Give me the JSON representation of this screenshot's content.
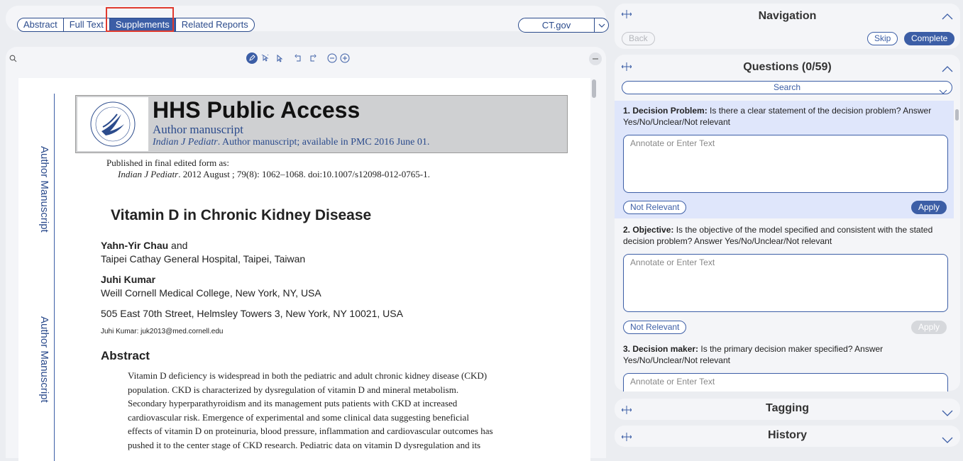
{
  "tabs": [
    {
      "label": "Abstract",
      "active": false
    },
    {
      "label": "Full Text",
      "active": false
    },
    {
      "label": "Supplements",
      "active": true
    },
    {
      "label": "Related Reports",
      "active": false
    }
  ],
  "source_select": {
    "value": "CT.gov"
  },
  "document": {
    "side_label_top": "Author Manuscript",
    "side_label_bottom": "Author Manuscript",
    "banner_title": "HHS Public Access",
    "banner_sub1": "Author manuscript",
    "banner_sub2_journal": "Indian J Pediatr",
    "banner_sub2_rest": ". Author manuscript; available in PMC 2016 June 01.",
    "published_label": "Published in final edited form as:",
    "citation_journal": "Indian J Pediatr",
    "citation_rest": ". 2012 August ; 79(8): 1062–1068. doi:10.1007/s12098-012-0765-1.",
    "title": "Vitamin D in Chronic Kidney Disease",
    "author1_name": "Yahn-Yir Chau",
    "author1_and": " and",
    "author1_affil": "Taipei Cathay General Hospital, Taipei, Taiwan",
    "author2_name": "Juhi Kumar",
    "author2_affil": "Weill Cornell Medical College, New York, NY, USA",
    "address": "505 East 70th Street, Helmsley Towers 3, New York, NY 10021, USA",
    "email": "Juhi Kumar: juk2013@med.cornell.edu",
    "abstract_heading": "Abstract",
    "abstract_lines": [
      "Vitamin D deficiency is widespread in both the pediatric and adult chronic kidney disease (CKD)",
      "population. CKD is characterized by dysregulation of vitamin D and mineral metabolism.",
      "Secondary hyperparathyroidism and its management puts patients with CKD at increased",
      "cardiovascular risk. Emergence of experimental and some clinical data suggesting beneficial",
      "effects of vitamin D on proteinuria, blood pressure, inflammation and cardiovascular outcomes has",
      "pushed it to the center stage of CKD research. Pediatric data on vitamin D dysregulation and its"
    ]
  },
  "navigation": {
    "title": "Navigation",
    "back_label": "Back",
    "skip_label": "Skip",
    "complete_label": "Complete"
  },
  "questions_panel": {
    "title": "Questions (0/59)",
    "search_label": "Search",
    "annotate_placeholder": "Annotate or Enter Text",
    "not_relevant_label": "Not Relevant",
    "apply_label": "Apply",
    "items": [
      {
        "number_title": "1. Decision Problem:",
        "text": " Is there a clear statement of the decision problem? Answer Yes/No/Unclear/Not relevant"
      },
      {
        "number_title": "2. Objective:",
        "text": " Is the objective of the model specified and consistent with the stated decision problem? Answer Yes/No/Unclear/Not relevant"
      },
      {
        "number_title": "3. Decision maker:",
        "text": " Is the primary decision maker specified? Answer Yes/No/Unclear/Not relevant"
      }
    ]
  },
  "tagging": {
    "title": "Tagging"
  },
  "history": {
    "title": "History"
  },
  "colors": {
    "accent": "#3c5ea6",
    "highlight": "#e03a2e",
    "selected_question_bg": "#dfe6fb"
  }
}
